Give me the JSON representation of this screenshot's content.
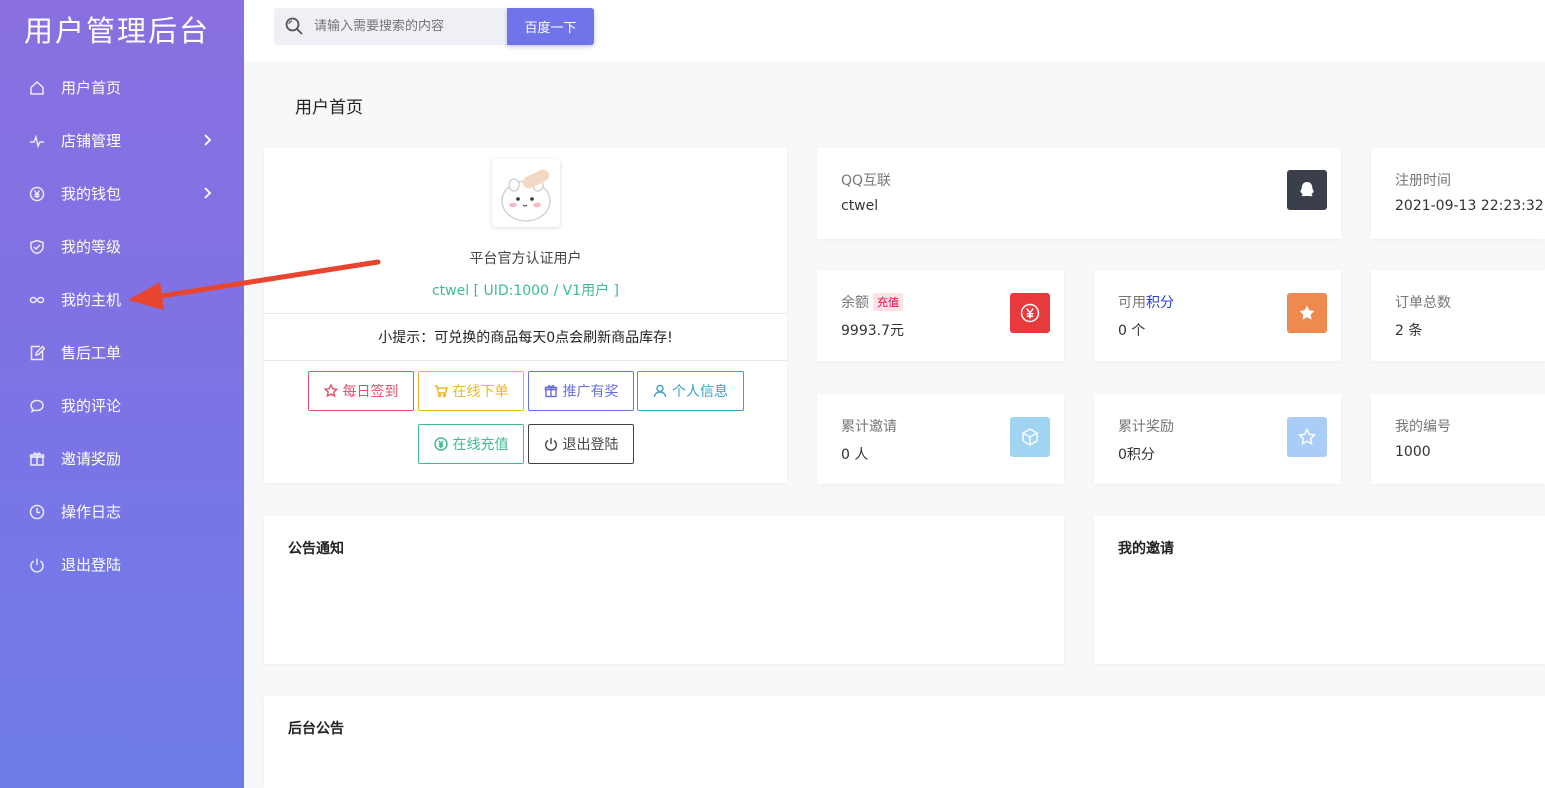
{
  "brand": "用户管理后台",
  "sidebar": {
    "items": [
      {
        "label": "用户首页",
        "icon": "home-icon",
        "has_arrow": false
      },
      {
        "label": "店铺管理",
        "icon": "pulse-icon",
        "has_arrow": true
      },
      {
        "label": "我的钱包",
        "icon": "yen-circle-icon",
        "has_arrow": true
      },
      {
        "label": "我的等级",
        "icon": "shield-check-icon",
        "has_arrow": false
      },
      {
        "label": "我的主机",
        "icon": "infinity-icon",
        "has_arrow": false
      },
      {
        "label": "售后工单",
        "icon": "edit-document-icon",
        "has_arrow": false
      },
      {
        "label": "我的评论",
        "icon": "chat-bubble-icon",
        "has_arrow": false
      },
      {
        "label": "邀请奖励",
        "icon": "gift-icon",
        "has_arrow": false
      },
      {
        "label": "操作日志",
        "icon": "clock-icon",
        "has_arrow": false
      },
      {
        "label": "退出登陆",
        "icon": "power-icon",
        "has_arrow": false
      }
    ]
  },
  "search": {
    "placeholder": "请输入需要搜索的内容",
    "button_label": "百度一下"
  },
  "page_title": "用户首页",
  "profile": {
    "role": "平台官方认证用户",
    "uid_line": "ctwel [ UID:1000 / V1用户 ]",
    "tip": "小提示：可兑换的商品每天0点会刷新商品库存!",
    "actions": [
      {
        "label": "每日签到",
        "icon": "star-outline-icon",
        "color": "#e0526b"
      },
      {
        "label": "在线下单",
        "icon": "cart-icon",
        "color": "#f0b429"
      },
      {
        "label": "推广有奖",
        "icon": "gift-icon",
        "color": "#6a6fe0"
      },
      {
        "label": "个人信息",
        "icon": "user-icon",
        "color": "#3aa0c8"
      },
      {
        "label": "在线充值",
        "icon": "yen-circle-icon",
        "color": "#3dbd8f"
      },
      {
        "label": "退出登陆",
        "icon": "power-icon",
        "color": "#444444"
      }
    ]
  },
  "stats": {
    "qq": {
      "label": "QQ互联",
      "value": "ctwel",
      "icon": "qq-icon",
      "color": "#3a3f4b"
    },
    "reg_time": {
      "label": "注册时间",
      "value": "2021-09-13 22:23:32"
    },
    "balance": {
      "label": "余额",
      "badge": "充值",
      "value": "9993.7元",
      "icon": "yen-circle-icon",
      "color": "#e8393f"
    },
    "points": {
      "label": "可用",
      "label_link": "积分",
      "value": "0 个",
      "icon": "star-icon",
      "color": "#ee8a4e"
    },
    "orders": {
      "label": "订单总数",
      "value": "2 条"
    },
    "invites": {
      "label": "累计邀请",
      "value": "0 人",
      "icon": "cube-icon",
      "color": "#9fd4f3"
    },
    "rewards": {
      "label": "累计奖励",
      "value": "0积分",
      "icon": "star-outline-icon",
      "color": "#a9cdf7"
    },
    "my_no": {
      "label": "我的编号",
      "value": "1000"
    }
  },
  "sections": {
    "notice": "公告通知",
    "my_invite": "我的邀请",
    "admin_notice": "后台公告"
  },
  "annotation_color": "#e8452f"
}
